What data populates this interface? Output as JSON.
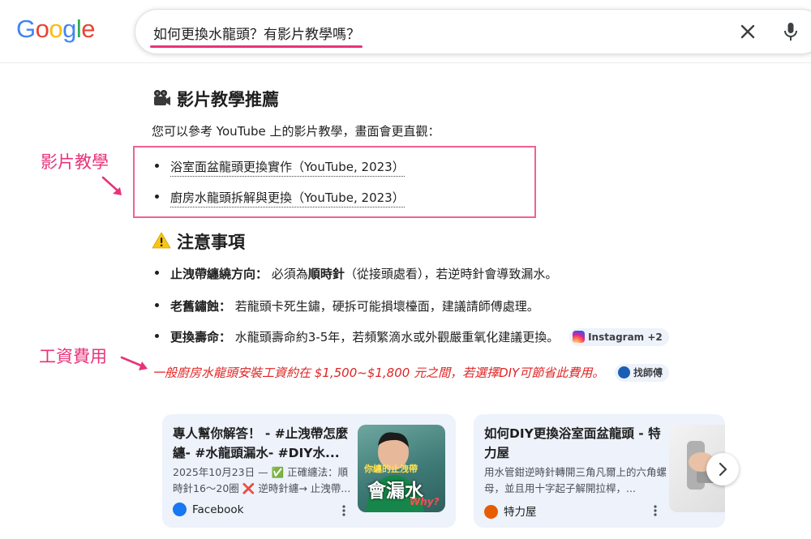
{
  "logo": {
    "letters": [
      "G",
      "o",
      "o",
      "g",
      "l",
      "e"
    ],
    "colors": [
      "#4285F4",
      "#EA4335",
      "#FBBC05",
      "#4285F4",
      "#34A853",
      "#EA4335"
    ]
  },
  "search": {
    "query": "如何更換水龍頭？有影片教學嗎？",
    "clear_icon": "close-icon",
    "mic_icon": "microphone-icon"
  },
  "video_section": {
    "emoji": "movie-camera-icon",
    "heading": "影片教學推薦",
    "intro": "您可以參考 YouTube 上的影片教學，畫面會更直觀：",
    "links": [
      "浴室面盆龍頭更換實作（YouTube, 2023）",
      "廚房水龍頭拆解與更換（YouTube, 2023）"
    ]
  },
  "annotations": {
    "video_label": "影片教學",
    "cost_label": "工資費用",
    "color": "#e8337a"
  },
  "notes_section": {
    "emoji": "warning-icon",
    "heading": "注意事項",
    "items": [
      {
        "label": "止洩帶纏繞方向：",
        "pre": "必須為",
        "bold": "順時針",
        "post": "（從接頭處看），若逆時針會導致漏水。"
      },
      {
        "label": "老舊鏽蝕：",
        "text": "若龍頭卡死生鏽，硬拆可能損壞檯面，建議請師傅處理。"
      },
      {
        "label": "更換壽命：",
        "text": "水龍頭壽命約3-5年，若頻繁滴水或外觀嚴重氧化建議更換。",
        "chip": "Instagram +2"
      }
    ],
    "cost_text": "一般廚房水龍頭安裝工資約在 $1,500~$1,800 元之間，若選擇DIY可節省此費用。",
    "cost_chip": "找師傅",
    "cost_color": "#e02424"
  },
  "cards": [
    {
      "title": "專人幫你解答！ - #止洩帶怎麼纏- #水龍頭漏水- #DIY水...",
      "snippet": "2025年10月23日 — ✅ 正確纏法：順時針16～20圈 ❌ 逆時針纏→ 止洩帶...",
      "source": "Facebook",
      "thumb_text_top": "你纏的止洩帶",
      "thumb_text_main": "會漏水",
      "thumb_text_sub": "Why?"
    },
    {
      "title": "如何DIY更換浴室面盆龍頭 - 特力屋",
      "snippet": "用水管鉗逆時針轉開三角凡爾上的六角螺母，並且用十字起子解開拉桿，...",
      "source": "特力屋"
    }
  ],
  "next_icon": "chevron-right-icon"
}
